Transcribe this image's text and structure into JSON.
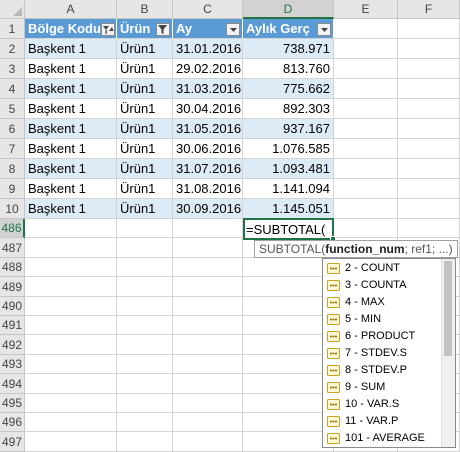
{
  "columns": [
    "A",
    "B",
    "C",
    "D",
    "E",
    "F"
  ],
  "table": {
    "headers": [
      "Bölge Kodu",
      "Ürün",
      "Ay",
      "Aylık Gerç"
    ],
    "rows": [
      {
        "row": "2",
        "region": "Başkent 1",
        "product": "Ürün1",
        "month": "31.01.2016",
        "value": "738.971"
      },
      {
        "row": "3",
        "region": "Başkent 1",
        "product": "Ürün1",
        "month": "29.02.2016",
        "value": "813.760"
      },
      {
        "row": "4",
        "region": "Başkent 1",
        "product": "Ürün1",
        "month": "31.03.2016",
        "value": "775.662"
      },
      {
        "row": "5",
        "region": "Başkent 1",
        "product": "Ürün1",
        "month": "30.04.2016",
        "value": "892.303"
      },
      {
        "row": "6",
        "region": "Başkent 1",
        "product": "Ürün1",
        "month": "31.05.2016",
        "value": "937.167"
      },
      {
        "row": "7",
        "region": "Başkent 1",
        "product": "Ürün1",
        "month": "30.06.2016",
        "value": "1.076.585"
      },
      {
        "row": "8",
        "region": "Başkent 1",
        "product": "Ürün1",
        "month": "31.07.2016",
        "value": "1.093.481"
      },
      {
        "row": "9",
        "region": "Başkent 1",
        "product": "Ürün1",
        "month": "31.08.2016",
        "value": "1.141.094"
      },
      {
        "row": "10",
        "region": "Başkent 1",
        "product": "Ürün1",
        "month": "30.09.2016",
        "value": "1.145.051"
      }
    ]
  },
  "header_row_number": "1",
  "empty_rows": [
    "486",
    "487",
    "488",
    "489",
    "490",
    "491",
    "492",
    "493",
    "494",
    "495",
    "496",
    "497"
  ],
  "active_cell": {
    "formula": "=SUBTOTAL("
  },
  "tooltip": {
    "fn": "SUBTOTAL(",
    "arg1": "function_num",
    "rest": "; ref1; ...)"
  },
  "autocomplete": [
    "2 - COUNT",
    "3 - COUNTA",
    "4 - MAX",
    "5 - MIN",
    "6 - PRODUCT",
    "7 - STDEV.S",
    "8 - STDEV.P",
    "9 - SUM",
    "10 - VAR.S",
    "11 - VAR.P",
    "101 - AVERAGE"
  ],
  "colors": {
    "accent": "#217346",
    "table_header": "#5b9bd5",
    "band": "#ddebf7"
  }
}
